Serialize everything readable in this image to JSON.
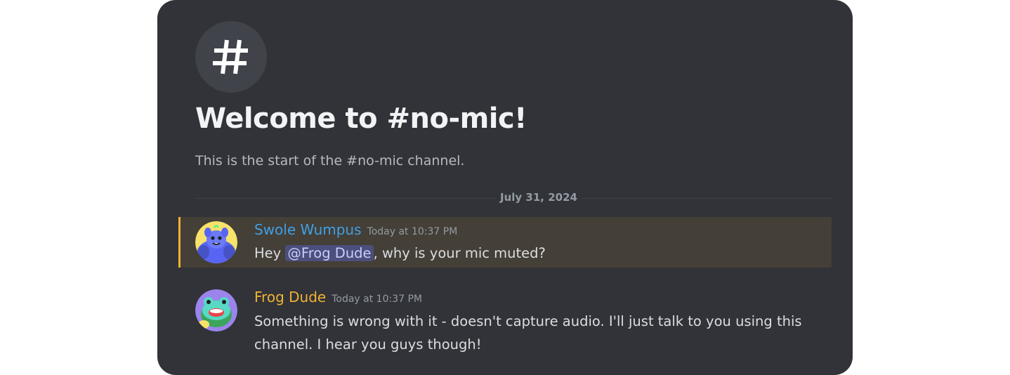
{
  "channel": {
    "icon": "hashtag-icon",
    "welcome_title": "Welcome to #no-mic!",
    "welcome_subtitle": "This is the start of the #no-mic channel.",
    "date_divider": "July 31, 2024"
  },
  "messages": [
    {
      "author": "Swole Wumpus",
      "author_color": "#3fa0e6",
      "timestamp": "Today at 10:37 PM",
      "avatar": "wumpus-avatar-icon",
      "highlighted": true,
      "text_before": "Hey ",
      "mention": "@Frog Dude",
      "text_after": ", why is your mic muted?"
    },
    {
      "author": "Frog Dude",
      "author_color": "#f0b232",
      "timestamp": "Today at 10:37 PM",
      "avatar": "frog-avatar-icon",
      "highlighted": false,
      "text": "Something is wrong with it - doesn't capture audio. I'll just talk to you using this channel. I hear you guys though!"
    }
  ],
  "colors": {
    "background": "#313338",
    "highlight_bg": "#443f37",
    "highlight_bar": "#f0b232",
    "mention_bg": "#4b4f7d"
  }
}
